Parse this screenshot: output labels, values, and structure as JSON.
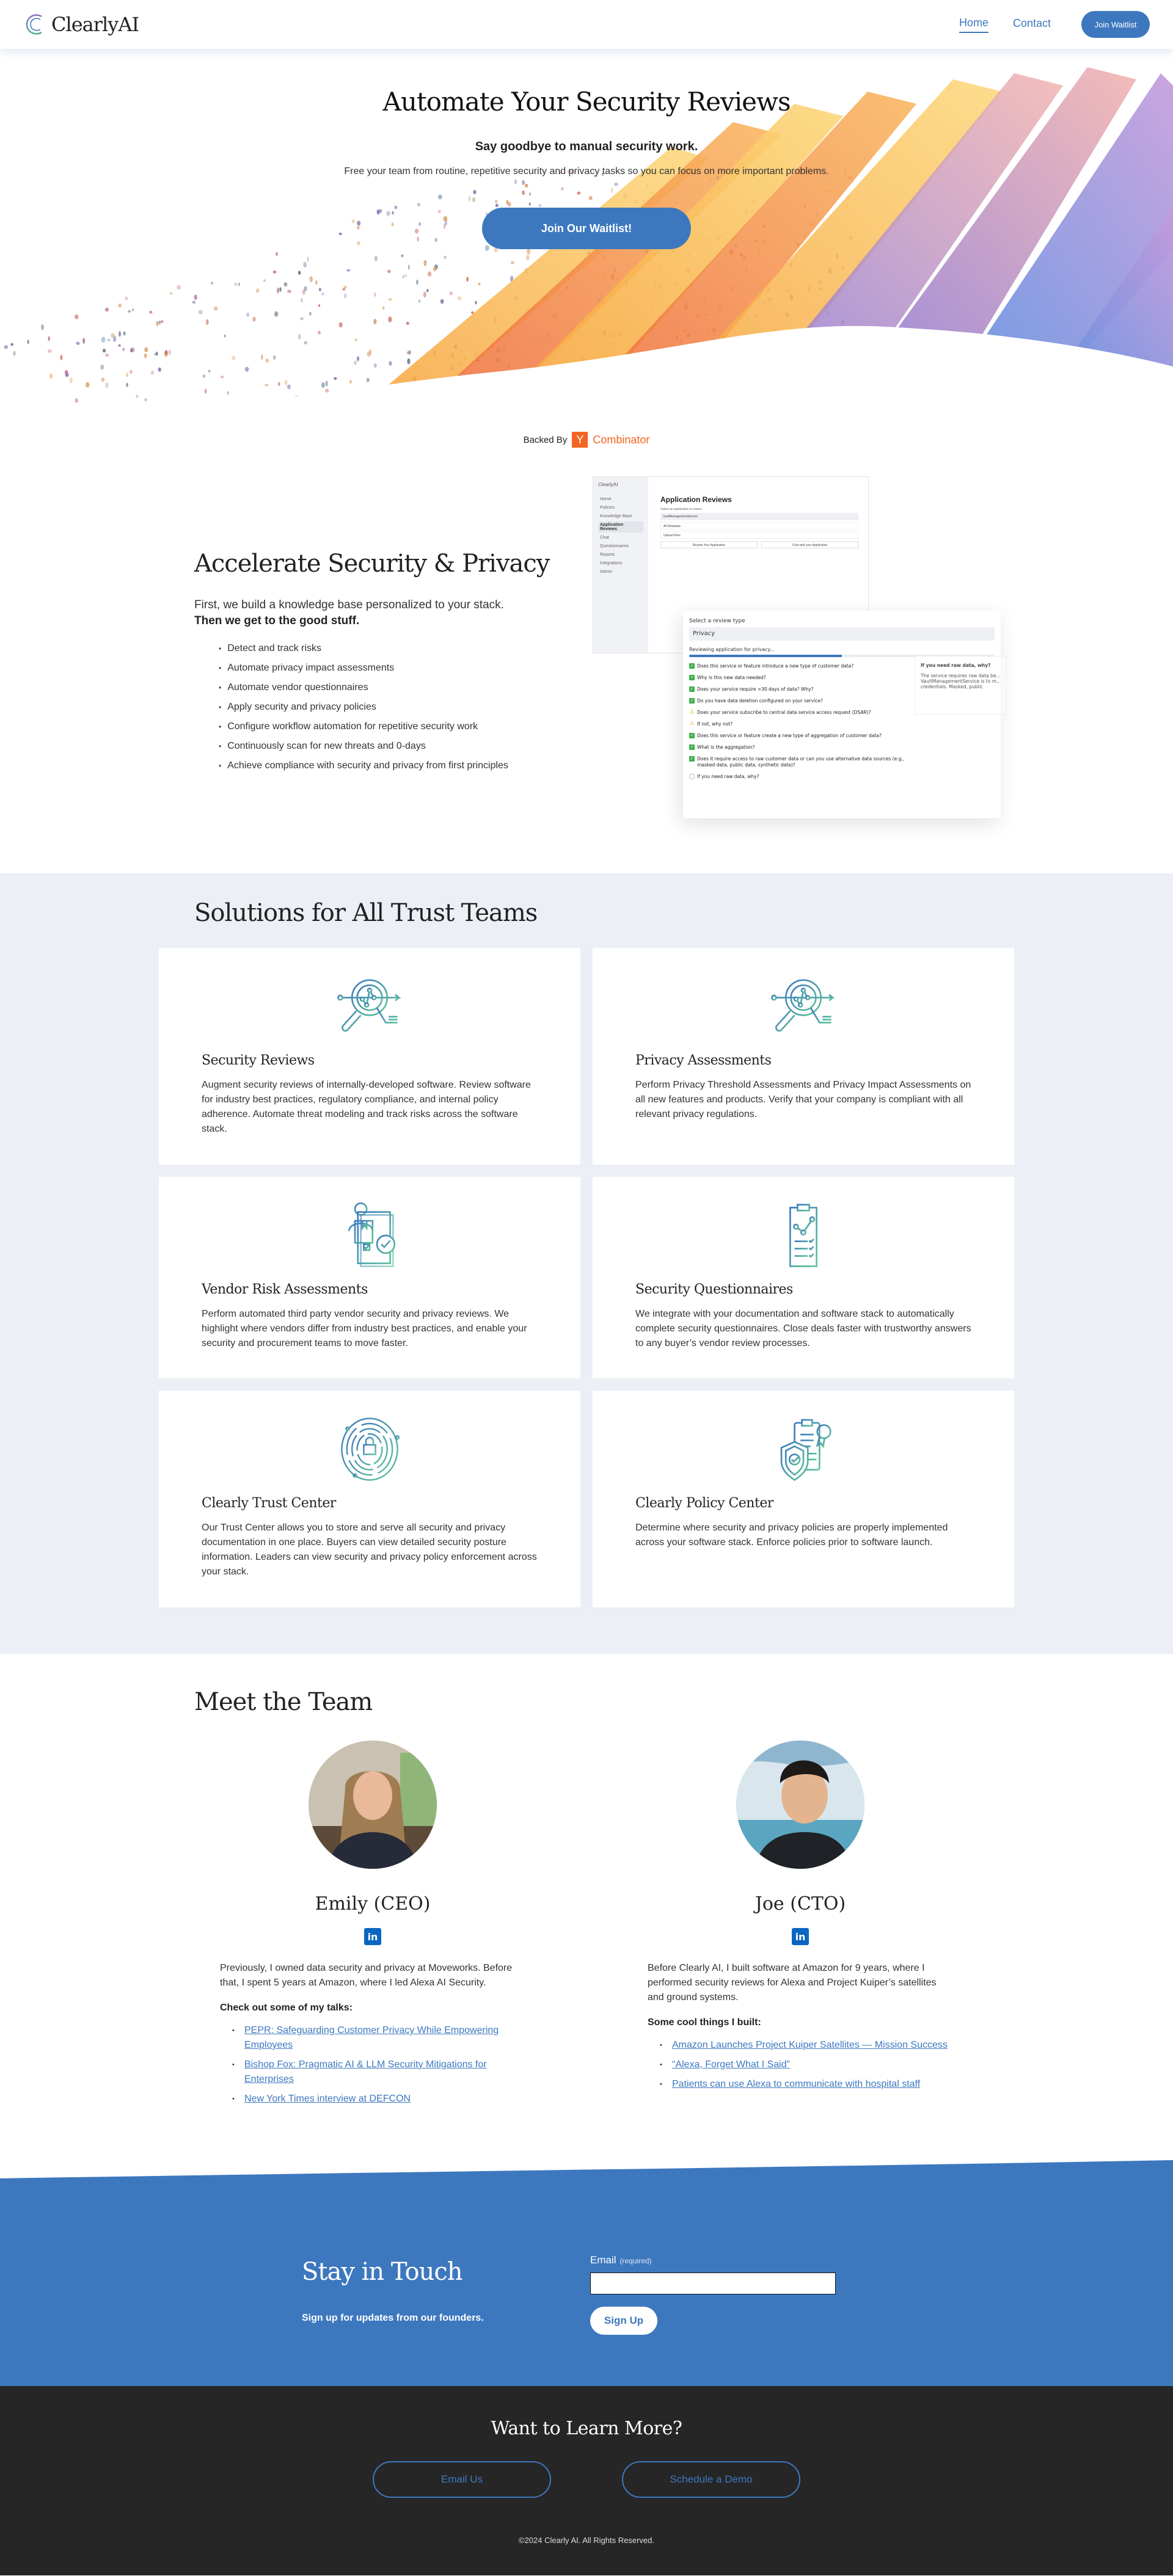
{
  "header": {
    "logo_text": "ClearlyAI",
    "nav": [
      {
        "label": "Home",
        "active": true
      },
      {
        "label": "Contact",
        "active": false
      }
    ],
    "cta_label": "Join Waitlist"
  },
  "hero": {
    "title": "Automate Your Security Reviews",
    "subtitle": "Say goodbye to manual security work.",
    "description": "Free your team from routine, repetitive security and privacy tasks so you can focus on more important problems.",
    "cta_label": "Join Our Waitlist!"
  },
  "backed": {
    "label": "Backed By",
    "yc_letter": "Y",
    "yc_name": "Combinator"
  },
  "accelerate": {
    "title": "Accelerate Security & Privacy",
    "intro": "First, we build a knowledge base personalized to your stack.",
    "intro_bold": "Then we get to the good stuff.",
    "items": [
      "Detect and track risks",
      "Automate privacy impact assessments",
      "Automate vendor questionnaires",
      "Apply security and privacy policies",
      "Configure workflow automation for repetitive security work",
      "Continuously scan for new threats and 0-days",
      "Achieve compliance with security and privacy from first principles"
    ]
  },
  "app_preview": {
    "brand": "ClearlyAI",
    "sidebar": [
      "Home",
      "Policies",
      "Knowledge Base",
      "Application Reviews",
      "Chat",
      "Questionnaires",
      "Reports",
      "Integrations",
      "Admin"
    ],
    "active_item": "Application Reviews",
    "page_title": "Application Reviews",
    "select_label": "Select an application to review",
    "selected_app": "VaultManagementService",
    "filter_1": "All Metadata",
    "filter_2": "Upload Files",
    "btn_review": "Review Your Application",
    "btn_chat": "Chat with your Application",
    "review_type_label": "Select a review type",
    "review_type": "Privacy",
    "status": "Reviewing application for privacy...",
    "progress_percent": 50,
    "questions": [
      {
        "status": "ok",
        "text": "Does this service or feature introduce a new type of customer data?"
      },
      {
        "status": "ok",
        "text": "Why is this new data needed?"
      },
      {
        "status": "ok",
        "text": "Does your service require >30 days of data? Why?"
      },
      {
        "status": "ok",
        "text": "Do you have data deletion configured on your service?"
      },
      {
        "status": "warn",
        "text": "Does your service subscribe to central data service access request (DSAR)?"
      },
      {
        "status": "warn",
        "text": "If not, why not?"
      },
      {
        "status": "ok",
        "text": "Does this service or feature create a new type of aggregation of customer data?"
      },
      {
        "status": "ok",
        "text": "What is the aggregation?"
      },
      {
        "status": "ok",
        "text": "Does it require access to raw customer data or can you use alternative data sources (e.g., masked data, public data, synthetic data)?"
      },
      {
        "status": "pending",
        "text": "If you need raw data, why?"
      }
    ],
    "answer_title": "If you need raw data, why?",
    "answer_text": "The service requires raw data be... VaultManagementService is to m... credentials. Masked, public"
  },
  "solutions": {
    "title": "Solutions for All Trust Teams",
    "cards": [
      {
        "icon": "magnifier-analytics-icon",
        "title": "Security Reviews",
        "text": "Augment security reviews of internally-developed software. Review software for industry best practices, regulatory compliance, and internal policy adherence. Automate threat modeling and track risks across the software stack."
      },
      {
        "icon": "magnifier-analytics-icon",
        "title": "Privacy Assessments",
        "text": "Perform Privacy Threshold Assessments and Privacy Impact Assessments on all new features and products.  Verify that your company is compliant with all relevant privacy regulations."
      },
      {
        "icon": "vendor-checklist-icon",
        "title": "Vendor Risk Assessments",
        "text": "Perform automated third party vendor security and privacy reviews. We highlight where vendors differ from industry best practices, and enable your security and procurement teams to move faster."
      },
      {
        "icon": "clipboard-chart-icon",
        "title": "Security Questionnaires",
        "text": "We integrate with your documentation and software stack to automatically complete security questionnaires. Close deals faster with trustworthy answers to any buyer’s vendor review processes."
      },
      {
        "icon": "fingerprint-lock-icon",
        "title": "Clearly Trust Center",
        "text": "Our Trust Center allows you to store and serve all security and privacy documentation in one place. Buyers can view detailed security posture information. Leaders can view security and privacy policy enforcement across your stack."
      },
      {
        "icon": "shield-policy-icon",
        "title": "Clearly Policy Center",
        "text": "Determine where security and privacy policies are properly implemented across your software stack. Enforce policies prior to software launch."
      }
    ]
  },
  "team": {
    "title": "Meet the Team",
    "members": [
      {
        "name": "Emily (CEO)",
        "linkedin": "in",
        "bio": "Previously, I owned data security and privacy at Moveworks. Before that, I spent 5 years at Amazon, where I led Alexa AI Security.",
        "links_heading": "Check out some of my talks:",
        "links": [
          "PEPR: Safeguarding Customer Privacy While Empowering Employees",
          "Bishop Fox: Pragmatic AI & LLM Security Mitigations for Enterprises",
          "New York Times interview at DEFCON"
        ]
      },
      {
        "name": "Joe (CTO)",
        "linkedin": "in",
        "bio": "Before Clearly AI, I built software at Amazon for 9 years, where I performed security reviews for Alexa and Project Kuiper’s satellites and ground systems.",
        "links_heading": "Some cool things I built:",
        "links": [
          "Amazon Launches Project Kuiper Satellites — Mission Success",
          "“Alexa, Forget What I Said”",
          "Patients can use Alexa to communicate with hospital staff"
        ]
      }
    ]
  },
  "touch": {
    "title": "Stay in Touch",
    "subtitle": "Sign up for updates from our founders.",
    "email_label": "Email",
    "email_required": "(required)",
    "email_value": "",
    "signup_label": "Sign Up"
  },
  "footer": {
    "title": "Want to Learn More?",
    "email_btn": "Email Us",
    "demo_btn": "Schedule a Demo",
    "copyright": "©2024 Clearly AI. All Rights Reserved."
  },
  "colors": {
    "brand_blue": "#3d78bf",
    "yc_orange": "#f26522",
    "footer_bg": "#262626",
    "solutions_bg": "#eceff5"
  }
}
